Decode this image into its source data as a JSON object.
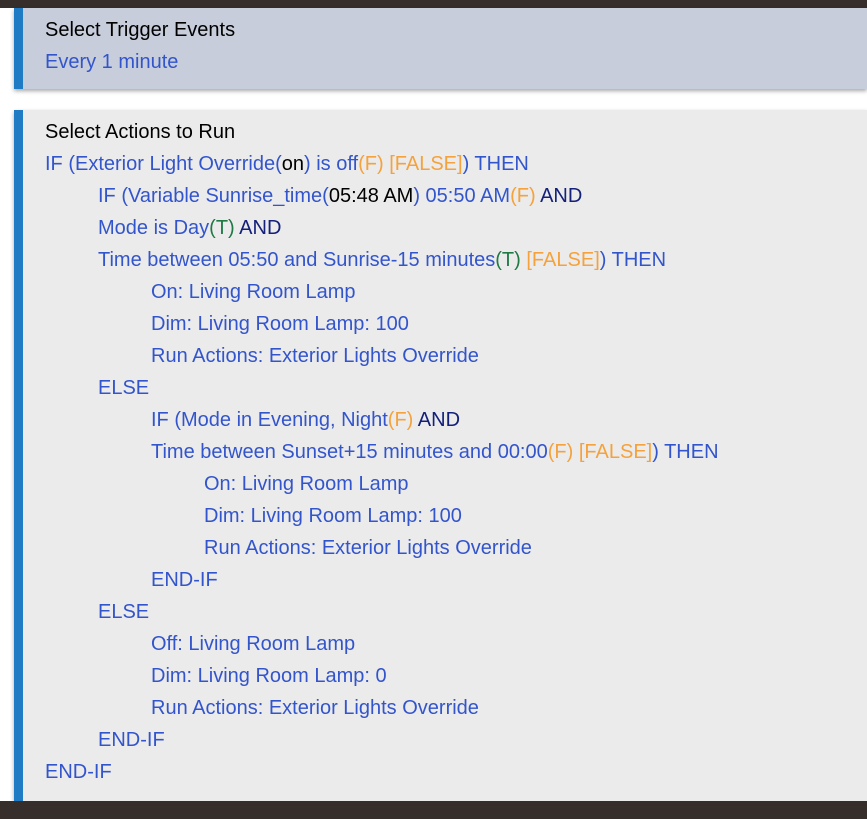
{
  "window": {
    "top_bar_color": "#362e2b",
    "accent_color": "#1f7bc4"
  },
  "trigger_panel": {
    "title": "Select Trigger Events",
    "background": "#c7cdda",
    "triggers": [
      {
        "text": "Every 1 minute"
      }
    ]
  },
  "actions_panel": {
    "title": "Select Actions to Run",
    "background": "#ebebeb",
    "colors": {
      "statement": "#3355cc",
      "value": "#000000",
      "false_flag": "#f5a23c",
      "true_flag": "#1f7a44",
      "operator": "#14207a"
    },
    "lines": [
      {
        "indent": 0,
        "segments": [
          {
            "text": "IF (Exterior Light Override(",
            "style": "blue"
          },
          {
            "text": "on",
            "style": "black"
          },
          {
            "text": ") is off",
            "style": "blue"
          },
          {
            "text": "(F)",
            "style": "orange"
          },
          {
            "text": " ",
            "style": "blue"
          },
          {
            "text": "[FALSE]",
            "style": "orange"
          },
          {
            "text": ") THEN",
            "style": "blue"
          }
        ]
      },
      {
        "indent": 1,
        "segments": [
          {
            "text": "IF (Variable Sunrise_time(",
            "style": "blue"
          },
          {
            "text": "05:48 AM",
            "style": "black"
          },
          {
            "text": ") 05:50 AM",
            "style": "blue"
          },
          {
            "text": "(F)",
            "style": "orange"
          },
          {
            "text": "  ",
            "style": "blue"
          },
          {
            "text": "AND",
            "style": "navy"
          }
        ]
      },
      {
        "indent": 1,
        "segments": [
          {
            "text": "Mode is Day",
            "style": "blue"
          },
          {
            "text": "(T)",
            "style": "green"
          },
          {
            "text": "  ",
            "style": "blue"
          },
          {
            "text": "AND",
            "style": "navy"
          }
        ]
      },
      {
        "indent": 1,
        "segments": [
          {
            "text": "Time between 05:50 and Sunrise-15 minutes",
            "style": "blue"
          },
          {
            "text": "(T)",
            "style": "green"
          },
          {
            "text": " ",
            "style": "blue"
          },
          {
            "text": "[FALSE]",
            "style": "orange"
          },
          {
            "text": ") THEN",
            "style": "blue"
          }
        ]
      },
      {
        "indent": 2,
        "segments": [
          {
            "text": "On: Living Room Lamp",
            "style": "blue"
          }
        ]
      },
      {
        "indent": 2,
        "segments": [
          {
            "text": "Dim: Living Room Lamp: 100",
            "style": "blue"
          }
        ]
      },
      {
        "indent": 2,
        "segments": [
          {
            "text": "Run Actions: Exterior Lights Override",
            "style": "blue"
          }
        ]
      },
      {
        "indent": 1,
        "segments": [
          {
            "text": "ELSE",
            "style": "blue"
          }
        ]
      },
      {
        "indent": 2,
        "segments": [
          {
            "text": "IF (Mode in Evening, Night",
            "style": "blue"
          },
          {
            "text": "(F)",
            "style": "orange"
          },
          {
            "text": "  ",
            "style": "blue"
          },
          {
            "text": "AND",
            "style": "navy"
          }
        ]
      },
      {
        "indent": 2,
        "segments": [
          {
            "text": "Time between Sunset+15 minutes and 00:00",
            "style": "blue"
          },
          {
            "text": "(F)",
            "style": "orange"
          },
          {
            "text": " ",
            "style": "blue"
          },
          {
            "text": "[FALSE]",
            "style": "orange"
          },
          {
            "text": ") THEN",
            "style": "blue"
          }
        ]
      },
      {
        "indent": 3,
        "segments": [
          {
            "text": "On: Living Room Lamp",
            "style": "blue"
          }
        ]
      },
      {
        "indent": 3,
        "segments": [
          {
            "text": "Dim: Living Room Lamp: 100",
            "style": "blue"
          }
        ]
      },
      {
        "indent": 3,
        "segments": [
          {
            "text": "Run Actions: Exterior Lights Override",
            "style": "blue"
          }
        ]
      },
      {
        "indent": 2,
        "segments": [
          {
            "text": "END-IF",
            "style": "blue"
          }
        ]
      },
      {
        "indent": 1,
        "segments": [
          {
            "text": "ELSE",
            "style": "blue"
          }
        ]
      },
      {
        "indent": 2,
        "segments": [
          {
            "text": "Off: Living Room Lamp",
            "style": "blue"
          }
        ]
      },
      {
        "indent": 2,
        "segments": [
          {
            "text": "Dim: Living Room Lamp: 0",
            "style": "blue"
          }
        ]
      },
      {
        "indent": 2,
        "segments": [
          {
            "text": "Run Actions: Exterior Lights Override",
            "style": "blue"
          }
        ]
      },
      {
        "indent": 1,
        "segments": [
          {
            "text": "END-IF",
            "style": "blue"
          }
        ]
      },
      {
        "indent": 0,
        "segments": [
          {
            "text": "END-IF",
            "style": "blue"
          }
        ]
      }
    ]
  }
}
